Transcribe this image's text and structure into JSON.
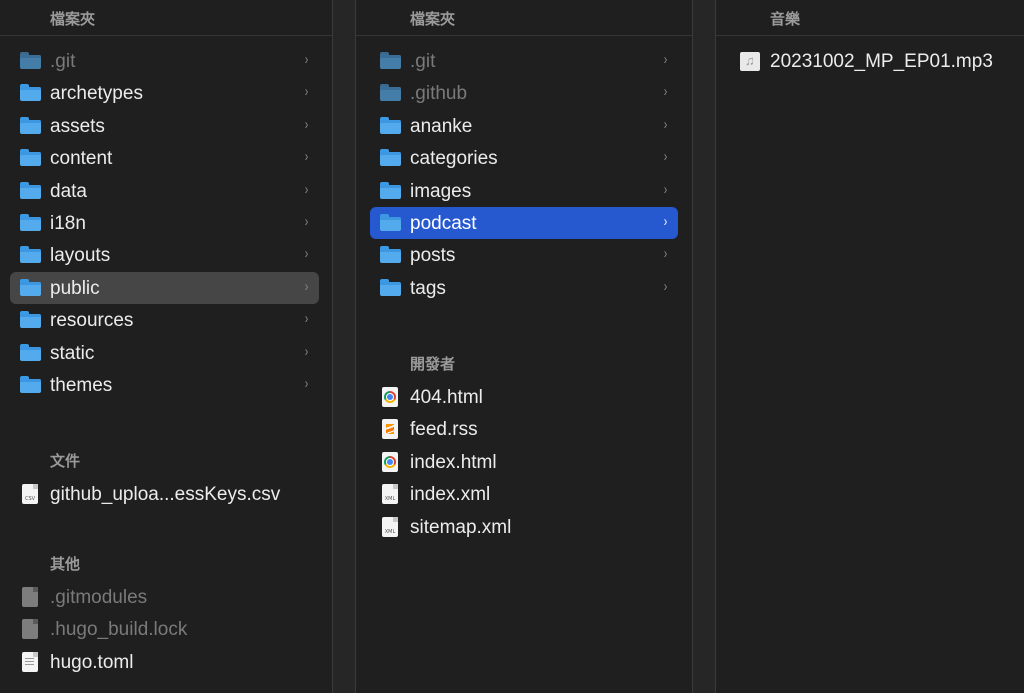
{
  "columns": [
    {
      "header": "檔案夾",
      "folders": [
        {
          "name": ".git",
          "dim": true
        },
        {
          "name": "archetypes",
          "dim": false
        },
        {
          "name": "assets",
          "dim": false
        },
        {
          "name": "content",
          "dim": false
        },
        {
          "name": "data",
          "dim": false
        },
        {
          "name": "i18n",
          "dim": false
        },
        {
          "name": "layouts",
          "dim": false
        },
        {
          "name": "public",
          "dim": false,
          "selected": "gray"
        },
        {
          "name": "resources",
          "dim": false
        },
        {
          "name": "static",
          "dim": false
        },
        {
          "name": "themes",
          "dim": false
        }
      ],
      "documents_title": "文件",
      "documents": [
        {
          "name": "github_uploa...essKeys.csv",
          "icon": "csv-file-icon",
          "tag": "CSV"
        }
      ],
      "others_title": "其他",
      "others": [
        {
          "name": ".gitmodules",
          "icon": "generic-file-icon",
          "dim": true
        },
        {
          "name": ".hugo_build.lock",
          "icon": "generic-file-icon",
          "dim": true
        },
        {
          "name": "hugo.toml",
          "icon": "text-file-icon",
          "dim": false
        }
      ]
    },
    {
      "header": "檔案夾",
      "folders": [
        {
          "name": ".git",
          "dim": true
        },
        {
          "name": ".github",
          "dim": true
        },
        {
          "name": "ananke",
          "dim": false
        },
        {
          "name": "categories",
          "dim": false
        },
        {
          "name": "images",
          "dim": false
        },
        {
          "name": "podcast",
          "dim": false,
          "selected": "blue"
        },
        {
          "name": "posts",
          "dim": false
        },
        {
          "name": "tags",
          "dim": false
        }
      ],
      "developer_title": "開發者",
      "developer": [
        {
          "name": "404.html",
          "icon": "chrome-html-icon"
        },
        {
          "name": "feed.rss",
          "icon": "sublime-rss-icon"
        },
        {
          "name": "index.html",
          "icon": "chrome-html-icon"
        },
        {
          "name": "index.xml",
          "icon": "xml-file-icon",
          "tag": "XML"
        },
        {
          "name": "sitemap.xml",
          "icon": "xml-file-icon",
          "tag": "XML"
        }
      ]
    },
    {
      "header": "音樂",
      "files": [
        {
          "name": "20231002_MP_EP01.mp3",
          "icon": "audio-file-icon"
        }
      ]
    }
  ],
  "chevron": "›",
  "music_note": "♫"
}
